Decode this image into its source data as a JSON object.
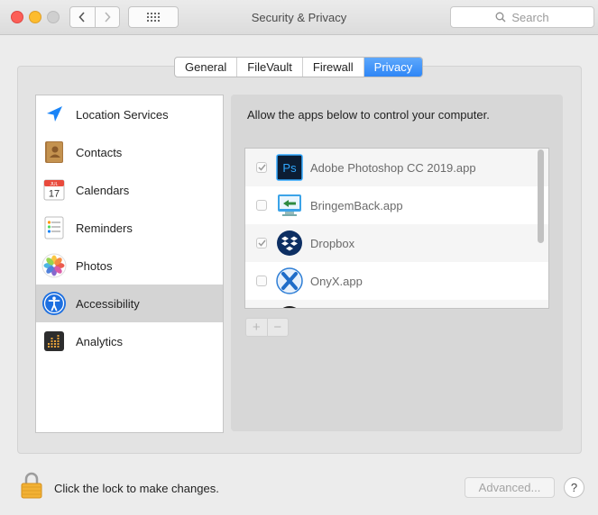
{
  "window": {
    "title": "Security & Privacy",
    "search_placeholder": "Search"
  },
  "tabs": [
    {
      "label": "General",
      "active": false
    },
    {
      "label": "FileVault",
      "active": false
    },
    {
      "label": "Firewall",
      "active": false
    },
    {
      "label": "Privacy",
      "active": true
    }
  ],
  "sidebar": {
    "items": [
      {
        "label": "Location Services",
        "icon": "location-arrow-icon",
        "selected": false
      },
      {
        "label": "Contacts",
        "icon": "contacts-book-icon",
        "selected": false
      },
      {
        "label": "Calendars",
        "icon": "calendar-icon",
        "selected": false
      },
      {
        "label": "Reminders",
        "icon": "reminders-list-icon",
        "selected": false
      },
      {
        "label": "Photos",
        "icon": "photos-flower-icon",
        "selected": false
      },
      {
        "label": "Accessibility",
        "icon": "accessibility-person-icon",
        "selected": true
      },
      {
        "label": "Analytics",
        "icon": "analytics-bars-icon",
        "selected": false
      }
    ]
  },
  "calendar_icon": {
    "month": "JUL",
    "day": "17"
  },
  "main": {
    "instruction": "Allow the apps below to control your computer.",
    "apps": [
      {
        "name": "Adobe Photoshop CC 2019.app",
        "checked": true,
        "icon": "photoshop-icon"
      },
      {
        "name": "BringemBack.app",
        "checked": false,
        "icon": "bringemback-icon"
      },
      {
        "name": "Dropbox",
        "checked": true,
        "icon": "dropbox-icon"
      },
      {
        "name": "OnyX.app",
        "checked": false,
        "icon": "onyx-icon"
      }
    ],
    "add_label": "+",
    "remove_label": "−"
  },
  "photoshop_icon_text": "Ps",
  "footer": {
    "lock_text": "Click the lock to make changes.",
    "advanced_label": "Advanced...",
    "help_label": "?"
  },
  "colors": {
    "accent": "#2e86f6",
    "close": "#fc5f57",
    "minimize": "#fdbc2e"
  }
}
